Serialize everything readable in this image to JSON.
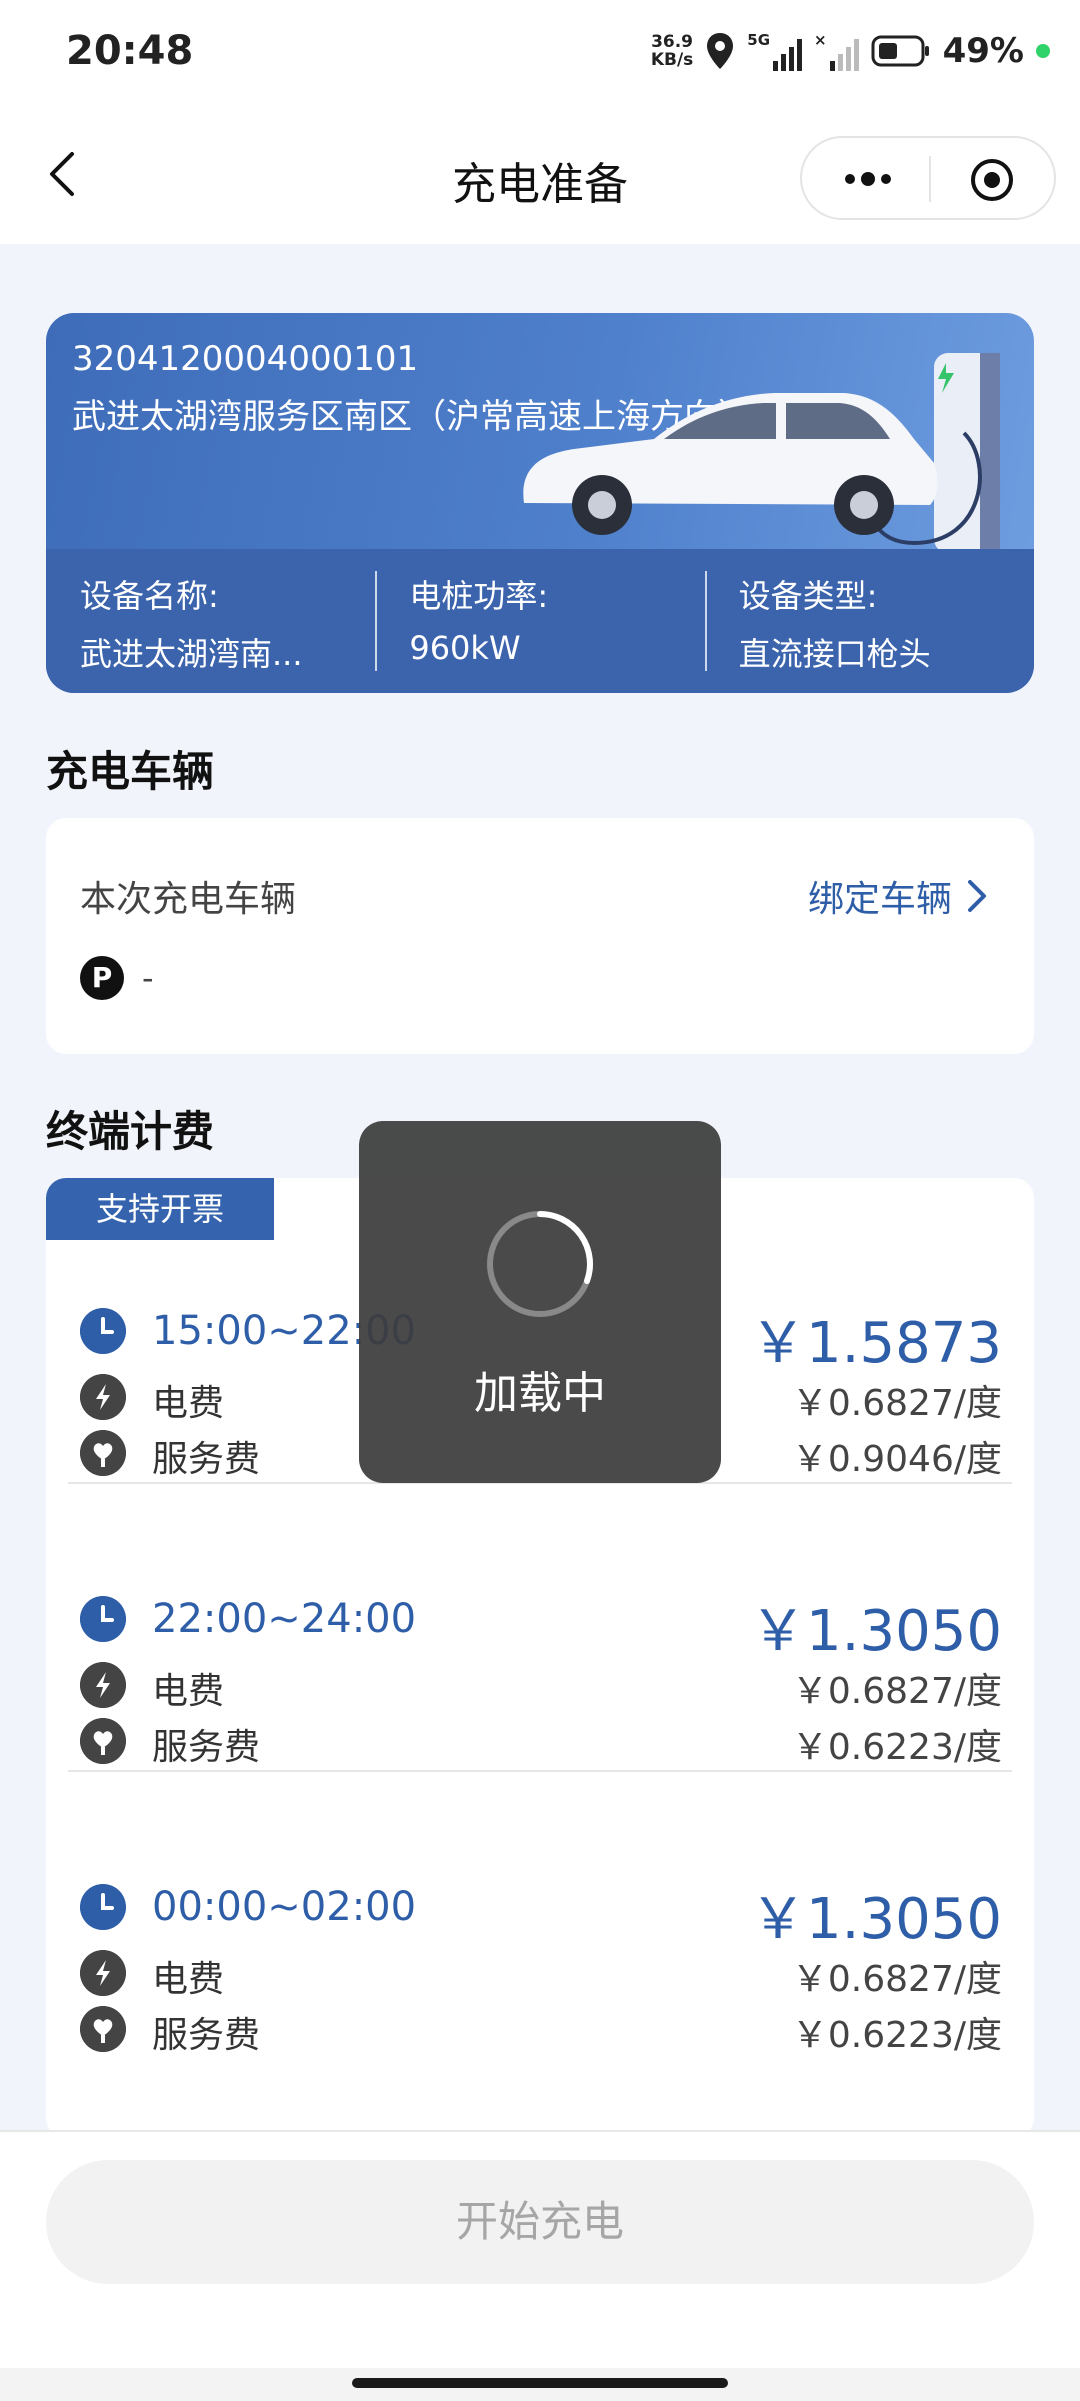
{
  "status_bar": {
    "time": "20:48",
    "net_speed_value": "36.9",
    "net_speed_unit": "KB/s",
    "network": "5G",
    "battery": "49%"
  },
  "nav": {
    "title": "充电准备"
  },
  "station": {
    "id": "3204120004000101",
    "name": "武进太湖湾服务区南区（沪常高速上海方向）",
    "device_name_label": "设备名称:",
    "device_name_value": "武进太湖湾南...",
    "power_label": "电桩功率:",
    "power_value": "960kW",
    "device_type_label": "设备类型:",
    "device_type_value": "直流接口枪头"
  },
  "vehicle_section": {
    "title": "充电车辆",
    "label": "本次充电车辆",
    "bind_link": "绑定车辆",
    "plate_badge": "P",
    "plate_value": "-"
  },
  "fee_section": {
    "title": "终端计费",
    "invoice_tag": "支持开票",
    "periods": [
      {
        "time": "15:00~22:00",
        "total": "￥1.5873",
        "electricity_label": "电费",
        "electricity_price": "￥0.6827/度",
        "service_label": "服务费",
        "service_price": "￥0.9046/度"
      },
      {
        "time": "22:00~24:00",
        "total": "￥1.3050",
        "electricity_label": "电费",
        "electricity_price": "￥0.6827/度",
        "service_label": "服务费",
        "service_price": "￥0.6223/度"
      },
      {
        "time": "00:00~02:00",
        "total": "￥1.3050",
        "electricity_label": "电费",
        "electricity_price": "￥0.6827/度",
        "service_label": "服务费",
        "service_price": "￥0.6223/度"
      }
    ]
  },
  "bottom": {
    "start_button": "开始充电"
  },
  "loading": {
    "text": "加载中"
  },
  "colors": {
    "accent": "#2f5ea8",
    "card_blue": "#3b64ad",
    "page_bg": "#f1f4fa",
    "toast_bg": "#3c3c3c"
  }
}
